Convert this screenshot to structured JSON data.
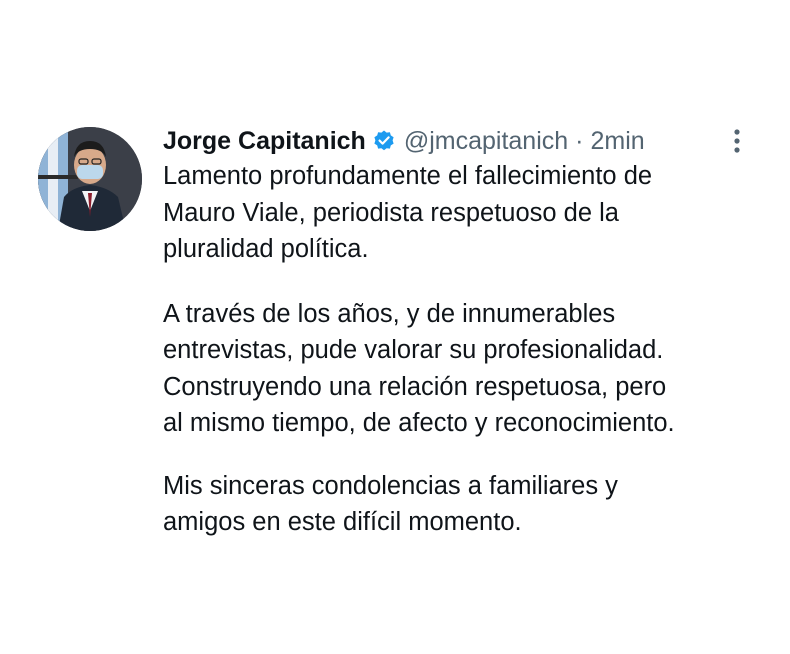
{
  "tweet": {
    "author": {
      "display_name": "Jorge Capitanich",
      "verified_icon": "verified-badge-icon",
      "handle": "@jmcapitanich",
      "separator": "·",
      "time": "2min"
    },
    "more_icon": "more-vertical-icon",
    "paragraphs": [
      {
        "lines": [
          "Lamento profundamente el fallecimiento de",
          "Mauro Viale, periodista respetuoso de la",
          "pluralidad política."
        ]
      },
      {
        "lines": [
          "A través de los años, y de innumerables",
          "entrevistas, pude valorar su profesionalidad.",
          "Construyendo una relación respetuosa, pero",
          "al mismo tiempo, de afecto y reconocimiento."
        ]
      },
      {
        "lines": [
          "Mis sinceras condolencias a familiares y",
          "amigos en este difícil momento."
        ]
      }
    ]
  },
  "colors": {
    "text": "#0f1419",
    "secondary_text": "#536471",
    "verified_blue": "#1d9bf0",
    "background": "#ffffff"
  }
}
